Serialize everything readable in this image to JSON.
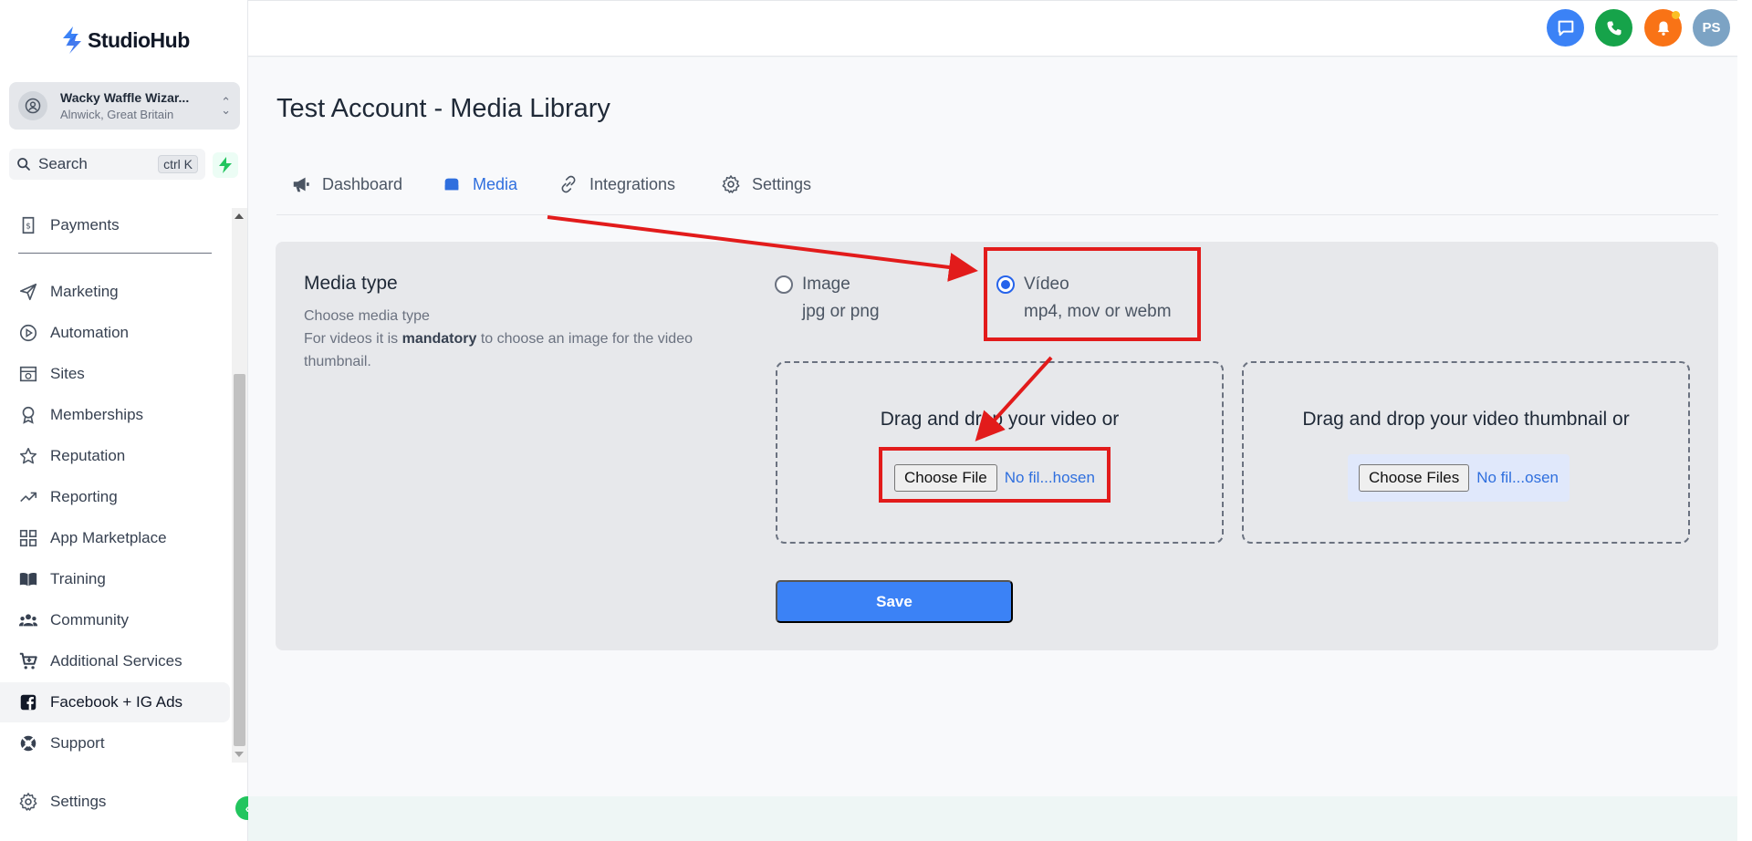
{
  "brand": {
    "name": "StudioHub"
  },
  "account": {
    "name": "Wacky Waffle Wizar...",
    "location": "Alnwick, Great Britain"
  },
  "search": {
    "label": "Search",
    "shortcut": "ctrl K"
  },
  "sidebar": {
    "items": [
      {
        "label": "Payments",
        "icon": "dollar-doc-icon"
      },
      {
        "label": "Marketing",
        "icon": "paper-plane-icon"
      },
      {
        "label": "Automation",
        "icon": "play-circle-icon"
      },
      {
        "label": "Sites",
        "icon": "globe-icon"
      },
      {
        "label": "Memberships",
        "icon": "award-icon"
      },
      {
        "label": "Reputation",
        "icon": "star-icon"
      },
      {
        "label": "Reporting",
        "icon": "trending-up-icon"
      },
      {
        "label": "App Marketplace",
        "icon": "grid-icon"
      },
      {
        "label": "Training",
        "icon": "book-icon"
      },
      {
        "label": "Community",
        "icon": "users-icon"
      },
      {
        "label": "Additional Services",
        "icon": "cart-icon"
      },
      {
        "label": "Facebook + IG Ads",
        "icon": "facebook-icon"
      },
      {
        "label": "Support",
        "icon": "life-ring-icon"
      }
    ],
    "active": "Facebook + IG Ads",
    "settings_label": "Settings"
  },
  "topbar": {
    "avatar_initials": "PS",
    "colors": {
      "chat": "#3b82f6",
      "phone": "#16a34a",
      "bell": "#f97316",
      "avatar": "#7ca3c4"
    }
  },
  "page": {
    "title": "Test Account - Media Library"
  },
  "tabs": [
    {
      "label": "Dashboard",
      "icon": "megaphone-icon"
    },
    {
      "label": "Media",
      "icon": "folder-icon"
    },
    {
      "label": "Integrations",
      "icon": "link-icon"
    },
    {
      "label": "Settings",
      "icon": "gear-icon"
    }
  ],
  "active_tab": "Media",
  "media_type": {
    "title": "Media type",
    "desc_line1": "Choose media type",
    "desc_pre": "For videos it is ",
    "desc_bold": "mandatory",
    "desc_post": " to choose an image for the video thumbnail.",
    "options": [
      {
        "label": "Image",
        "hint": "jpg or png",
        "selected": false
      },
      {
        "label": "Vídeo",
        "hint": "mp4, mov or webm",
        "selected": true
      }
    ]
  },
  "upload_video": {
    "text": "Drag and drop your video or",
    "button": "Choose File",
    "status": "No fil...hosen"
  },
  "upload_thumb": {
    "text": "Drag and drop your video thumbnail or",
    "button": "Choose Files",
    "status": "No fil...osen"
  },
  "save_label": "Save",
  "colors": {
    "accent": "#3b82f6",
    "annotation": "#e21b1b",
    "active_tab": "#2f6fde"
  }
}
